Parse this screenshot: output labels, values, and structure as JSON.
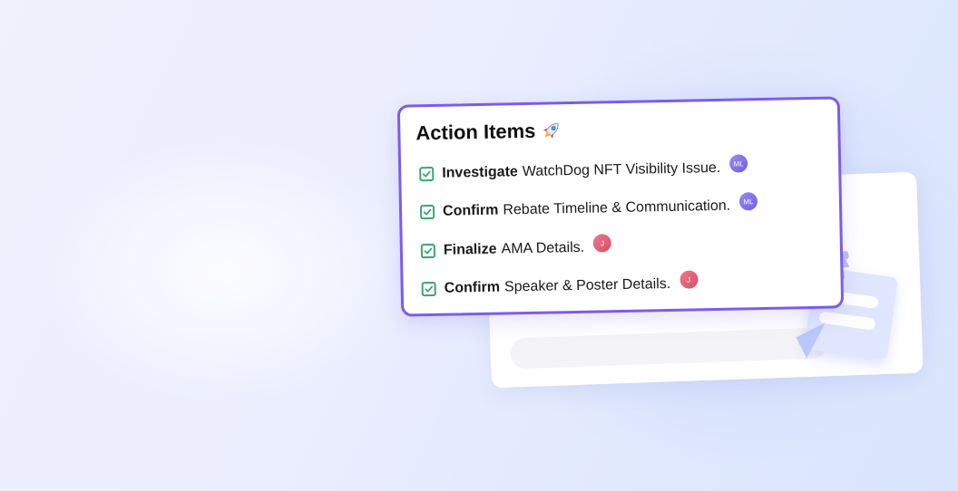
{
  "card": {
    "title": "Action Items",
    "title_icon": "rocket-icon",
    "accent_color": "#7b5cf0",
    "check_color": "#3aa76d"
  },
  "items": [
    {
      "verb": "Investigate",
      "text": "WatchDog NFT Visibility Issue.",
      "assignee": "ML",
      "checked": true
    },
    {
      "verb": "Confirm",
      "text": "Rebate Timeline & Communication.",
      "assignee": "ML",
      "checked": true
    },
    {
      "verb": "Finalize",
      "text": "AMA Details.",
      "assignee": "J",
      "checked": true
    },
    {
      "verb": "Confirm",
      "text": "Speaker & Poster Details.",
      "assignee": "J",
      "checked": true
    }
  ],
  "avatar_colors": {
    "ML": "#7b6ef0",
    "J": "#d9566f"
  }
}
